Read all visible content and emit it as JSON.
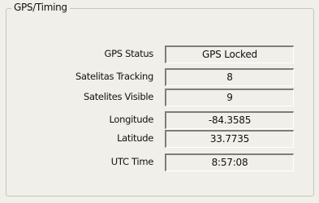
{
  "group": {
    "title": "GPS/Timing"
  },
  "fields": [
    {
      "label": "GPS Status",
      "value": "GPS Locked"
    },
    {
      "label": "Satelitas Tracking",
      "value": "8"
    },
    {
      "label": "Satelites Visible",
      "value": "9"
    },
    {
      "label": "Longitude",
      "value": "-84.3585"
    },
    {
      "label": "Latitude",
      "value": "33.7735"
    },
    {
      "label": "UTC Time",
      "value": "8:57:08"
    }
  ]
}
